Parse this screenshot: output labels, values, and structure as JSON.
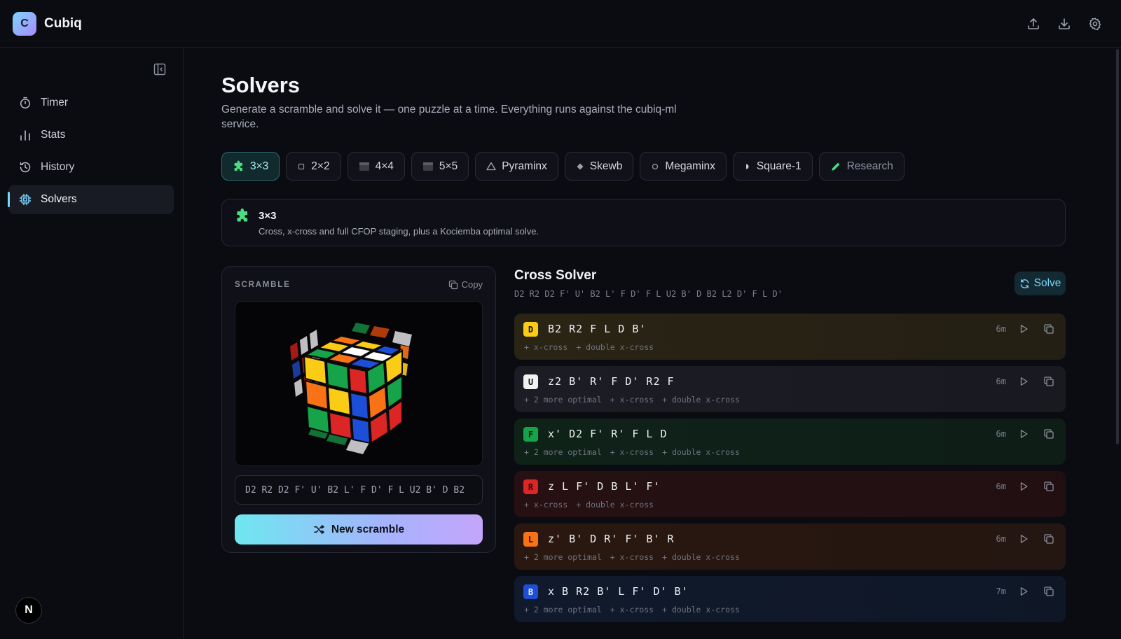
{
  "app": {
    "logo_letter": "C",
    "name": "Cubiq"
  },
  "header": {
    "icons": [
      "upload-icon",
      "download-icon",
      "settings-icon"
    ]
  },
  "sidebar": {
    "items": [
      {
        "label": "Timer",
        "icon": "stopwatch-icon",
        "active": false
      },
      {
        "label": "Stats",
        "icon": "bar-chart-icon",
        "active": false
      },
      {
        "label": "History",
        "icon": "history-icon",
        "active": false
      },
      {
        "label": "Solvers",
        "icon": "cpu-icon",
        "active": true
      }
    ],
    "avatar_letter": "N"
  },
  "page": {
    "title": "Solvers",
    "subtitle": "Generate a scramble and solve it — one puzzle at a time. Everything runs against the cubiq-ml service."
  },
  "tabs": [
    {
      "label": "3×3",
      "icon": "puzzle-icon",
      "active": true
    },
    {
      "label": "2×2",
      "icon": "small-square-icon",
      "active": false
    },
    {
      "label": "4×4",
      "icon": "square-icon",
      "active": false
    },
    {
      "label": "5×5",
      "icon": "square-icon",
      "active": false
    },
    {
      "label": "Pyraminx",
      "icon": "triangle-icon",
      "active": false
    },
    {
      "label": "Skewb",
      "icon": "diamond-icon",
      "active": false
    },
    {
      "label": "Megaminx",
      "icon": "circle-icon",
      "active": false
    },
    {
      "label": "Square-1",
      "icon": "half-circle-icon",
      "active": false
    },
    {
      "label": "Research",
      "icon": "pencil-icon",
      "active": false
    }
  ],
  "puzzle_info": {
    "title": "3×3",
    "description": "Cross, x-cross and full CFOP staging, plus a Kociemba optimal solve."
  },
  "scramble": {
    "label": "SCRAMBLE",
    "copy_label": "Copy",
    "value": "D2 R2 D2 F' U' B2 L' F D' F L U2 B' D B2",
    "new_button": "New scramble"
  },
  "solver": {
    "title": "Cross Solver",
    "scramble": "D2 R2 D2 F' U' B2 L' F D' F L U2 B' D B2 L2 D' F L D'",
    "solve_button": "Solve",
    "solutions": [
      {
        "face": "D",
        "face_color": "#facc15",
        "face_text": "#1a1400",
        "bg": "#2a2414",
        "moves": "B2 R2 F L D B'",
        "tags": [
          "+ x-cross",
          "+ double x-cross"
        ],
        "time": "6m"
      },
      {
        "face": "U",
        "face_color": "#f1f1f1",
        "face_text": "#111111",
        "bg": "#1c1d24",
        "moves": "z2 B' R' F D' R2 F",
        "tags": [
          "+ 2 more optimal",
          "+ x-cross",
          "+ double x-cross"
        ],
        "time": "6m"
      },
      {
        "face": "F",
        "face_color": "#16a34a",
        "face_text": "#062410",
        "bg": "#0f2218",
        "moves": "x' D2 F' R' F L D",
        "tags": [
          "+ 2 more optimal",
          "+ x-cross",
          "+ double x-cross"
        ],
        "time": "6m"
      },
      {
        "face": "R",
        "face_color": "#dc2626",
        "face_text": "#2a0505",
        "bg": "#261012",
        "moves": "z L F' D B L' F'",
        "tags": [
          "+ x-cross",
          "+ double x-cross"
        ],
        "time": "6m"
      },
      {
        "face": "L",
        "face_color": "#f97316",
        "face_text": "#2a1000",
        "bg": "#2a1810",
        "moves": "z' B' D R' F' B' R",
        "tags": [
          "+ 2 more optimal",
          "+ x-cross",
          "+ double x-cross"
        ],
        "time": "6m"
      },
      {
        "face": "B",
        "face_color": "#1d4ed8",
        "face_text": "#e6ecff",
        "bg": "#101a2c",
        "moves": "x B R2 B' L F' D' B'",
        "tags": [
          "+ 2 more optimal",
          "+ x-cross",
          "+ double x-cross"
        ],
        "time": "7m"
      }
    ]
  }
}
